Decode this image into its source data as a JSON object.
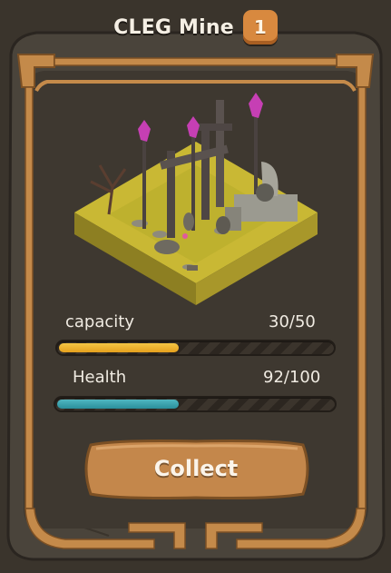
{
  "header": {
    "title": "CLEG Mine",
    "level": "1"
  },
  "stats": {
    "capacity": {
      "label": "capacity",
      "value_text": "30/50",
      "current": 30,
      "max": 50
    },
    "health": {
      "label": "Health",
      "value_text": "92/100",
      "current": 92,
      "max": 100
    }
  },
  "actions": {
    "collect_label": "Collect"
  },
  "colors": {
    "frame": "#c48a4a",
    "panel": "#3e3830",
    "capacity_fill": "#f0b62c",
    "health_fill": "#3aa3ad",
    "button": "#c4874b"
  },
  "image": {
    "icon": "isometric-mine-icon"
  }
}
